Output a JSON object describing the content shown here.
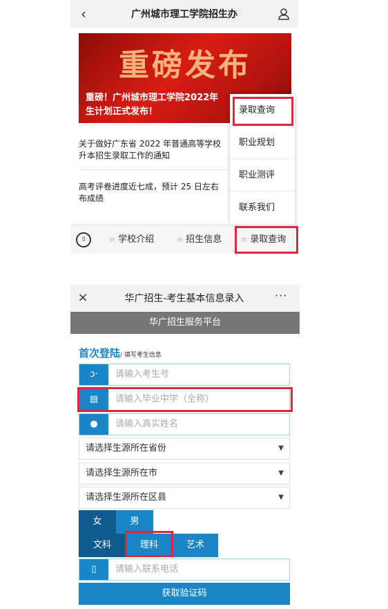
{
  "screen1": {
    "header": {
      "title": "广州城市理工学院招生办",
      "back": "‹",
      "ear_icon": "ear-icon",
      "person_icon": "person-icon"
    },
    "banner": {
      "big_text": "重磅发布",
      "caption_line1": "重磅！广州城市理工学院2022年",
      "caption_line2": "生计划正式发布！"
    },
    "articles": [
      {
        "line1": "关于做好广东省 2022 年普通高等学校",
        "line2": "升本招生录取工作的通知"
      },
      {
        "line1": "高考评卷进度近七成，预计 25 日左右",
        "line2": "布成绩"
      }
    ],
    "popup_menu": [
      "录取查询",
      "职业规划",
      "职业测评",
      "联系我们"
    ],
    "tabbar": {
      "keyboard_icon": "keyboard-icon",
      "tabs": [
        "学校介绍",
        "招生信息",
        "录取查询"
      ],
      "menu_glyph": "≡"
    }
  },
  "screen2": {
    "header": {
      "close": "×",
      "title": "华广招生-考生基本信息录入",
      "more": "···"
    },
    "platform_bar": "华广招生服务平台",
    "first_login": {
      "title": "首次登陆",
      "subtitle": "/ 填写考生信息"
    },
    "fields": [
      {
        "icon": "ↄ·",
        "icon_name": "id-icon",
        "placeholder": "请输入考生号"
      },
      {
        "icon": "▤",
        "icon_name": "school-icon",
        "placeholder": "请输入毕业中学（全称）"
      },
      {
        "icon": "●",
        "icon_name": "user-icon",
        "placeholder": "请输入真实姓名"
      }
    ],
    "selects": [
      "请选择生源所在省份",
      "请选择生源所在市",
      "请选择生源所在区县"
    ],
    "select_arrow": "▼",
    "gender": [
      "女",
      "男"
    ],
    "subjects": [
      "文科",
      "理科",
      "艺术"
    ],
    "phone": {
      "icon": "▯",
      "placeholder": "请输入联系电话"
    },
    "get_code": "获取验证码"
  },
  "colors": {
    "accent": "#1a86c7",
    "dark_accent": "#0f5a8e",
    "highlight": "#e2253f",
    "banner_red": "#d81d14"
  }
}
